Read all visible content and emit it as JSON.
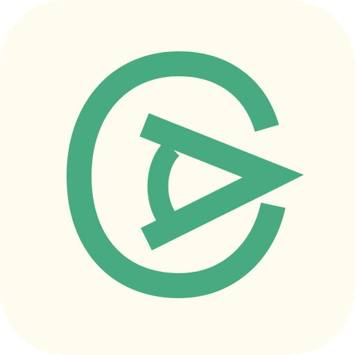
{
  "icon": {
    "name": "app-logo",
    "background_color": "#FDFCEF",
    "mark_color": "#47AA80"
  }
}
